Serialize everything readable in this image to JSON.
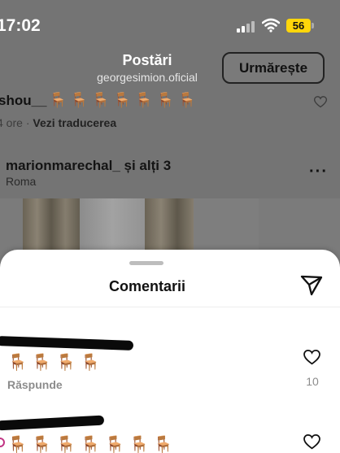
{
  "status_bar": {
    "time": "17:02",
    "battery": "56"
  },
  "post_header": {
    "title": "Postări",
    "subtitle": "georgesimion.oficial",
    "follow_label": "Urmărește"
  },
  "caption": {
    "username": "shou__",
    "chairs": "🪑🪑🪑🪑🪑🪑🪑",
    "time": "4 ore",
    "separator": "·",
    "translate": "Vezi traducerea"
  },
  "tagged": {
    "users": "marionmarechal_ și alți 3",
    "location": "Roma",
    "more": "···"
  },
  "sheet": {
    "title": "Comentarii"
  },
  "comments": [
    {
      "text": "🪑🪑🪑🪑",
      "reply": "Răspunde",
      "likes": "10"
    },
    {
      "text": "🪑🪑🪑🪑🪑🪑🪑"
    }
  ],
  "icons": {
    "send": "paper-plane-icon",
    "heart": "heart-outline-icon",
    "wifi": "wifi-icon",
    "signal": "cellular-signal-icon"
  },
  "colors": {
    "battery": "#ffd60a",
    "overlay": "#747474",
    "sheet": "#ffffff",
    "muted": "#8c8c8c"
  }
}
